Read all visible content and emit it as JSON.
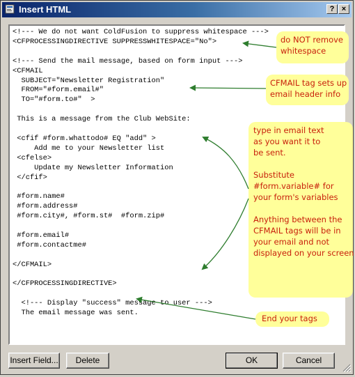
{
  "window": {
    "title": "Insert HTML",
    "help_label": "?",
    "close_label": "×"
  },
  "code_lines": [
    "<!--- We do not want ColdFusion to suppress whitespace --->",
    "<CFPROCESSINGDIRECTIVE SUPPRESSWHITESPACE=\"No\">",
    "",
    "<!--- Send the mail message, based on form input --->",
    "<CFMAIL",
    "  SUBJECT=\"Newsletter Registration\"",
    "  FROM=\"#form.email#\"",
    "  TO=\"#form.to#\"  >",
    "",
    " This is a message from the Club WebSite:",
    "",
    " <cfif #form.whattodo# EQ \"add\" >",
    "     Add me to your Newsletter list",
    " <cfelse>",
    "     Update my Newsletter Information",
    " </cfif>",
    "",
    " #form.name#",
    " #form.address#",
    " #form.city#, #form.st#  #form.zip#",
    "",
    " #form.email#",
    " #form.contactme#",
    "",
    "</CFMAIL>",
    "",
    "</CFPROCESSINGDIRECTIVE>",
    "",
    "  <!--- Display \"success\" message to user --->",
    "  The email message was sent."
  ],
  "notes": {
    "whitespace": [
      "do NOT remove",
      "whitespace"
    ],
    "cfmail": [
      "CFMAIL tag sets up",
      "email header info"
    ],
    "email_text": [
      "type in email text",
      "as you want it to",
      "be sent.",
      "",
      "Substitute",
      "#form.variable# for",
      "your form's variables",
      "",
      "Anything between the",
      "CFMAIL tags will be in",
      "your email and not",
      "displayed on your screen"
    ],
    "end_tags": [
      "End your tags"
    ]
  },
  "buttons": {
    "insert_field": "Insert Field...",
    "delete": "Delete",
    "ok": "OK",
    "cancel": "Cancel"
  },
  "colors": {
    "note_background": "#ffff9a",
    "note_text": "#c8200c",
    "arrow": "#2e7d2e",
    "titlebar": "#0a246a"
  }
}
